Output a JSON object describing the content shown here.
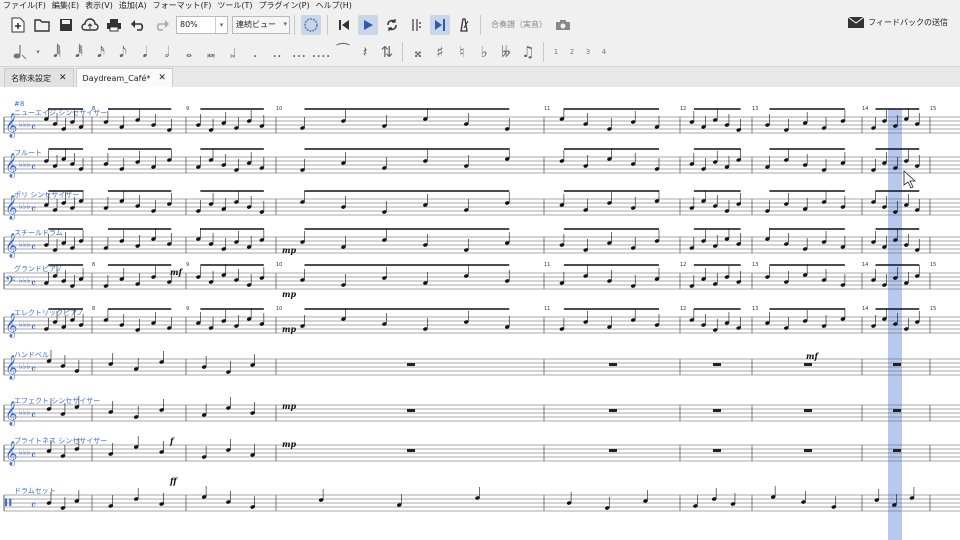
{
  "menu": [
    "ファイル(F)",
    "編集(E)",
    "表示(V)",
    "追加(A)",
    "フォーマット(F)",
    "ツール(T)",
    "プラグイン(P)",
    "ヘルプ(H)"
  ],
  "toolbar": {
    "zoom": "80%",
    "view_mode": "連続ビュー",
    "concert_pitch": "合奏譜（実音）",
    "feedback": "フィードバックの送信"
  },
  "notebar": {
    "voices": [
      "1",
      "2",
      "3",
      "4"
    ]
  },
  "tabs": [
    {
      "label": "名称未設定",
      "active": false
    },
    {
      "label": "Daydream_Café*",
      "active": true
    }
  ],
  "score": {
    "rehearsal": "#8",
    "measure_numbers": [
      "8",
      "9",
      "10",
      "11",
      "12",
      "13",
      "14",
      "15"
    ],
    "instruments": [
      {
        "name": "ニューエイジ シンセサイザー"
      },
      {
        "name": "フルート"
      },
      {
        "name": "ポリ シンセサイザー"
      },
      {
        "name": "スチールドラム"
      },
      {
        "name": "グランドピアノ"
      },
      {
        "name": "エレクトリックピアノ"
      },
      {
        "name": "ハンドベル"
      },
      {
        "name": "エフェクト シンセサイザー"
      },
      {
        "name": "ブライトネス シンセサイザー"
      },
      {
        "name": "ドラムセット"
      }
    ],
    "dynamics": [
      "mp",
      "mp",
      "mp",
      "mp",
      "mp",
      "mf",
      "mf",
      "f",
      "ff"
    ],
    "selection_color": "#b7c9ef",
    "label_color": "#3a6fd0"
  }
}
